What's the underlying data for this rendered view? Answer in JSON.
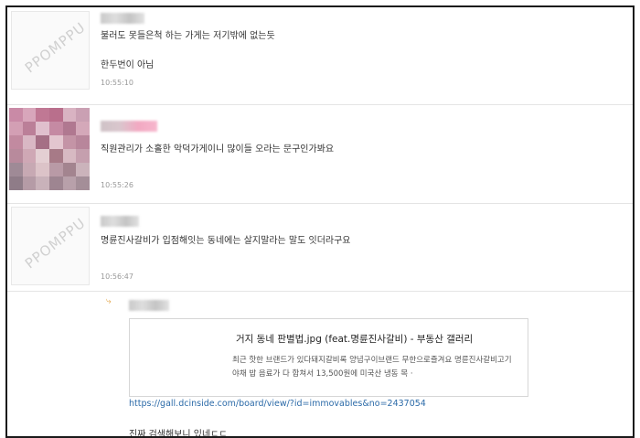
{
  "comments": [
    {
      "lines": [
        "불러도 못들은척 하는 가게는 저기밖에 없는듯",
        "한두번이 아님"
      ],
      "time": "10:55:10",
      "avatar": "ppomppu-default-avatar",
      "watermark": "PPOMPPU"
    },
    {
      "lines": [
        "직원관리가 소홀한 악덕가게이니 많이들 오라는 문구인가봐요"
      ],
      "time": "10:55:26",
      "avatar": "blurred-photo-avatar"
    },
    {
      "lines": [
        "명륜진사갈비가 입점해잇는 동네에는 살지말라는 말도 잇더라구요"
      ],
      "time": "10:56:47",
      "avatar": "ppomppu-default-avatar",
      "watermark": "PPOMPPU"
    }
  ],
  "reply": {
    "arrow_icon": "reply-arrow-icon",
    "card": {
      "title": "거지 동네 판별법.jpg (feat.명륜진사갈비) - 부동산 갤러리",
      "description": "최근 핫한 브랜드가 있다돼지갈비록 양념구이브랜드 무한으로즐겨요 명륜진사갈비고기 야채 밥 음료가 다 합쳐서 13,500원에 미국산 냉동 목 ·"
    },
    "link": "https://gall.dcinside.com/board/view/?id=immovables&no=2437054",
    "partial_text": "진짜 검색해보니 있네ㄷㄷ"
  },
  "colors": {
    "border": "#1a1a1a",
    "link": "#2b6aa8",
    "reply_arrow": "#e3a64a"
  }
}
